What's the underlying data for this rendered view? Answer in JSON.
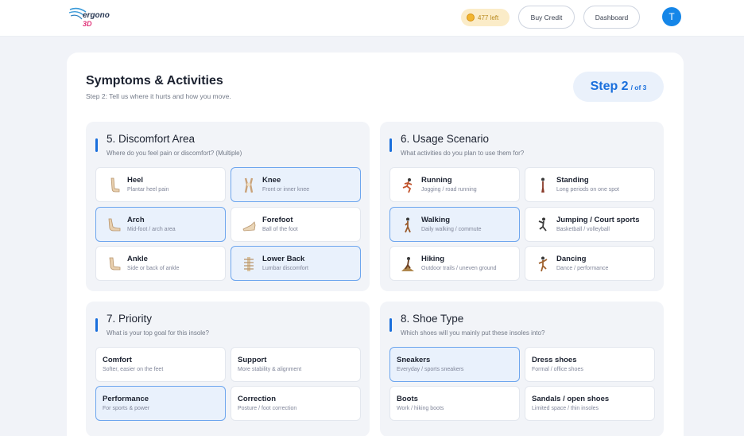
{
  "header": {
    "logo_text": "ergono",
    "logo_sub": "3D",
    "credits": "477 left",
    "buy_credit": "Buy Credit",
    "dashboard": "Dashboard",
    "avatar_initial": "T"
  },
  "page": {
    "title": "Symptoms & Activities",
    "subtitle": "Step 2: Tell us where it hurts and how you move.",
    "step_label": "Step 2",
    "step_of": "/ of 3"
  },
  "sections": {
    "discomfort": {
      "title": "5. Discomfort Area",
      "subtitle": "Where do you feel pain or discomfort? (Multiple)",
      "options": [
        {
          "title": "Heel",
          "desc": "Plantar heel pain",
          "icon": "heel-icon",
          "selected": false
        },
        {
          "title": "Knee",
          "desc": "Front or inner knee",
          "icon": "knee-icon",
          "selected": true
        },
        {
          "title": "Arch",
          "desc": "Mid-foot / arch area",
          "icon": "arch-icon",
          "selected": true
        },
        {
          "title": "Forefoot",
          "desc": "Ball of the foot",
          "icon": "forefoot-icon",
          "selected": false
        },
        {
          "title": "Ankle",
          "desc": "Side or back of ankle",
          "icon": "ankle-icon",
          "selected": false
        },
        {
          "title": "Lower Back",
          "desc": "Lumbar discomfort",
          "icon": "lower-back-icon",
          "selected": true
        }
      ]
    },
    "usage": {
      "title": "6. Usage Scenario",
      "subtitle": "What activities do you plan to use them for?",
      "options": [
        {
          "title": "Running",
          "desc": "Jogging / road running",
          "icon": "running-icon",
          "selected": false
        },
        {
          "title": "Standing",
          "desc": "Long periods on one spot",
          "icon": "standing-icon",
          "selected": false
        },
        {
          "title": "Walking",
          "desc": "Daily walking / commute",
          "icon": "walking-icon",
          "selected": true
        },
        {
          "title": "Jumping / Court sports",
          "desc": "Basketball / volleyball",
          "icon": "jumping-icon",
          "selected": false
        },
        {
          "title": "Hiking",
          "desc": "Outdoor trails / uneven ground",
          "icon": "hiking-icon",
          "selected": false
        },
        {
          "title": "Dancing",
          "desc": "Dance / performance",
          "icon": "dancing-icon",
          "selected": false
        }
      ]
    },
    "priority": {
      "title": "7. Priority",
      "subtitle": "What is your top goal for this insole?",
      "options": [
        {
          "title": "Comfort",
          "desc": "Softer, easier on the feet",
          "selected": false
        },
        {
          "title": "Support",
          "desc": "More stability & alignment",
          "selected": false
        },
        {
          "title": "Performance",
          "desc": "For sports & power",
          "selected": true
        },
        {
          "title": "Correction",
          "desc": "Posture / foot correction",
          "selected": false
        }
      ]
    },
    "shoe": {
      "title": "8. Shoe Type",
      "subtitle": "Which shoes will you mainly put these insoles into?",
      "options": [
        {
          "title": "Sneakers",
          "desc": "Everyday / sports sneakers",
          "selected": true
        },
        {
          "title": "Dress shoes",
          "desc": "Formal / office shoes",
          "selected": false
        },
        {
          "title": "Boots",
          "desc": "Work / hiking boots",
          "selected": false
        },
        {
          "title": "Sandals / open shoes",
          "desc": "Limited space / thin insoles",
          "selected": false
        }
      ]
    }
  },
  "colors": {
    "accent": "#1a6fdc",
    "selected_bg": "#e9f1fc",
    "selected_border": "#6ea6ee",
    "credit_pill": "#fbecc8"
  }
}
